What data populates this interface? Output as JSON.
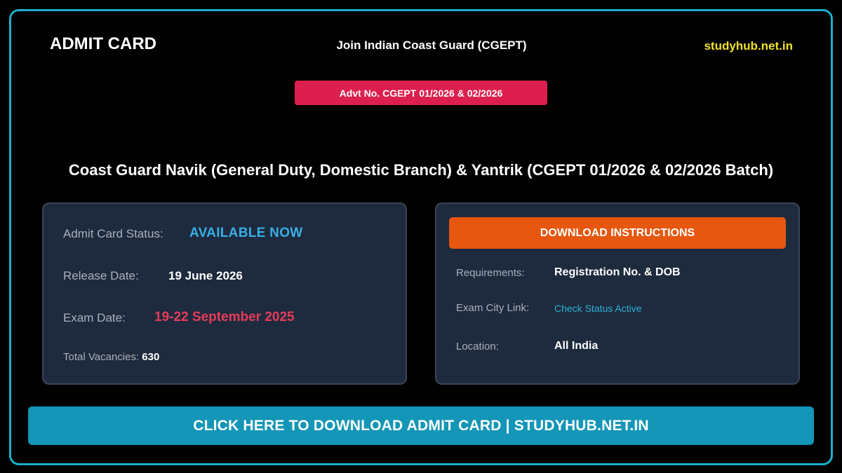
{
  "header": {
    "title": "ADMIT CARD",
    "subtitle": "Join Indian Coast Guard (CGEPT)",
    "site": "studyhub.net.in"
  },
  "advt_badge": "Advt No. CGEPT 01/2026 & 02/2026",
  "headline": "Coast Guard Navik (General Duty, Domestic Branch) & Yantrik (CGEPT 01/2026 & 02/2026 Batch)",
  "status_card": {
    "status_label": "Admit Card Status:",
    "status_value": "AVAILABLE NOW",
    "release_label": "Release Date:",
    "release_value": "19 June 2026",
    "exam_label": "Exam Date:",
    "exam_value": "19-22 September 2025",
    "vacancies_label": "Total Vacancies:",
    "vacancies_value": "630"
  },
  "instructions_card": {
    "button_label": "DOWNLOAD INSTRUCTIONS",
    "requirements_label": "Requirements:",
    "requirements_value": "Registration No. & DOB",
    "city_link_label": "Exam City Link:",
    "city_link_value": "Check Status Active",
    "location_label": "Location:",
    "location_value": "All India"
  },
  "cta_label": "CLICK HERE TO DOWNLOAD ADMIT CARD | STUDYHUB.NET.IN",
  "colors": {
    "frame_border": "#1ab0c8",
    "advt_badge": "#dc1f4f",
    "site_text": "#f2e12b",
    "available": "#38aee6",
    "exam_date": "#e63c5a",
    "download_button": "#e8570f",
    "cta_button": "#1396b7",
    "card_background": "#1e2a3d"
  }
}
